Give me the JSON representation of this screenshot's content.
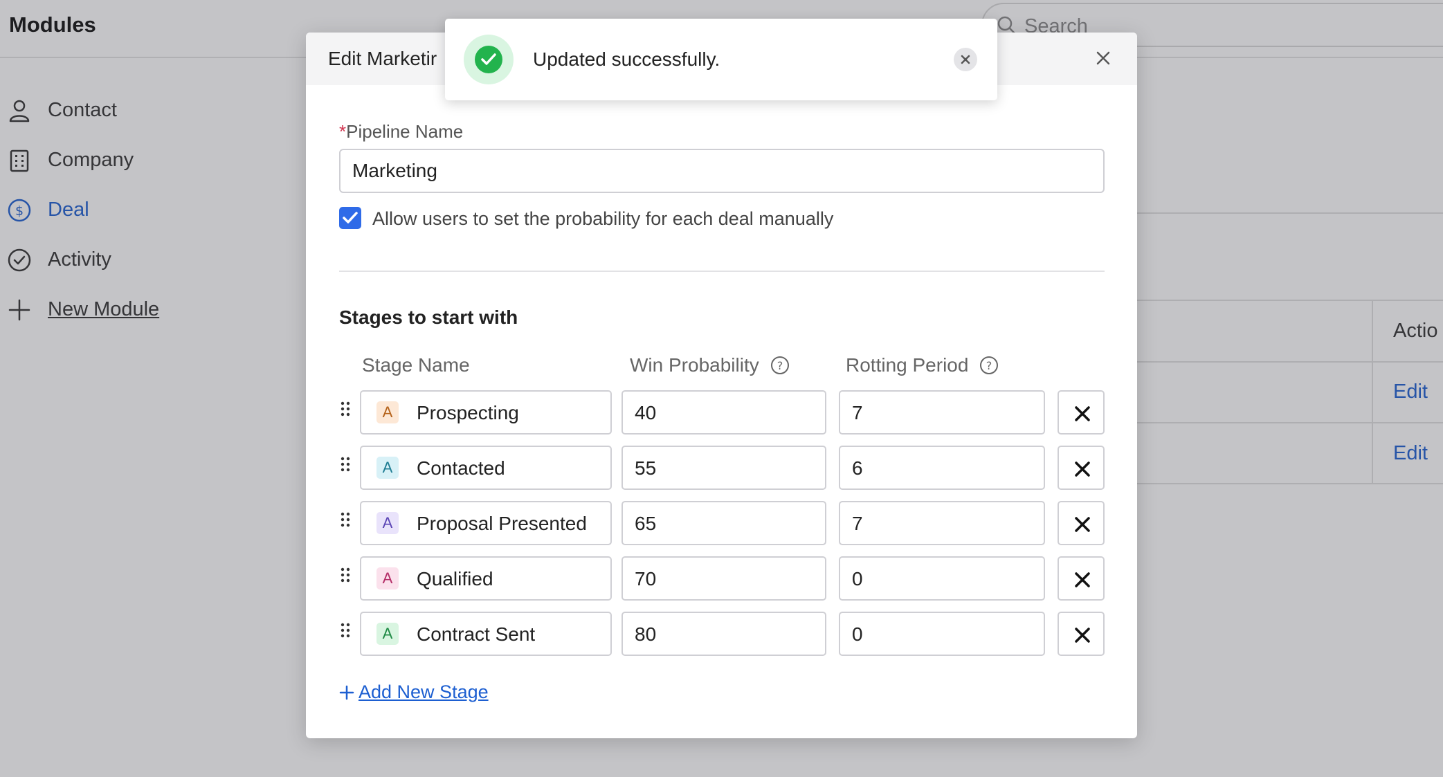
{
  "app": {
    "title": "Modules"
  },
  "search": {
    "placeholder": "Search"
  },
  "sidebar": {
    "items": [
      {
        "label": "Contact",
        "icon": "user-icon"
      },
      {
        "label": "Company",
        "icon": "building-icon"
      },
      {
        "label": "Deal",
        "icon": "dollar-circle-icon",
        "active": true
      },
      {
        "label": "Activity",
        "icon": "check-circle-icon"
      },
      {
        "label": "New Module",
        "icon": "plus-icon"
      }
    ]
  },
  "background_table": {
    "header": "Actio",
    "edit_label_1": "Edit",
    "edit_label_2": "Edit"
  },
  "modal": {
    "title": "Edit Marketir",
    "pipeline_label": "Pipeline Name",
    "required_marker": "*",
    "pipeline_value": "Marketing",
    "checkbox_label": "Allow users to set the probability for each deal manually",
    "checkbox_checked": true,
    "stages_title": "Stages to start with",
    "columns": {
      "stage_name": "Stage Name",
      "win_probability": "Win Probability",
      "rotting_period": "Rotting Period"
    },
    "stages": [
      {
        "badge": "A",
        "name": "Prospecting",
        "win": "40",
        "rot": "7",
        "badge_bg": "#fde8d6",
        "badge_fg": "#b5621a"
      },
      {
        "badge": "A",
        "name": "Contacted",
        "win": "55",
        "rot": "6",
        "badge_bg": "#d8f1f7",
        "badge_fg": "#1f7d93"
      },
      {
        "badge": "A",
        "name": "Proposal Presented",
        "win": "65",
        "rot": "7",
        "badge_bg": "#e9e3fb",
        "badge_fg": "#5b45b5"
      },
      {
        "badge": "A",
        "name": "Qualified",
        "win": "70",
        "rot": "0",
        "badge_bg": "#fbe1ec",
        "badge_fg": "#b42d67"
      },
      {
        "badge": "A",
        "name": "Contract Sent",
        "win": "80",
        "rot": "0",
        "badge_bg": "#d9f5e1",
        "badge_fg": "#1f8a45"
      }
    ],
    "add_stage_label": "Add New Stage"
  },
  "toast": {
    "message": "Updated successfully.",
    "status_color": "#22b34d"
  }
}
